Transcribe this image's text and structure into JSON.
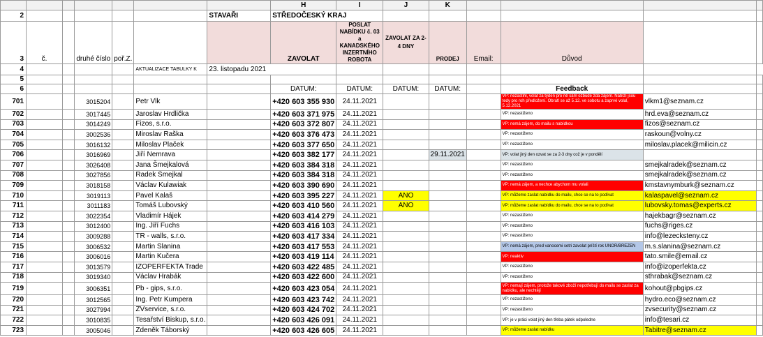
{
  "columns": [
    "H",
    "I",
    "J",
    "K"
  ],
  "header_row2": {
    "stavari": "STAVAŘI",
    "region": "STŘEDOČESKÝ KRAJ"
  },
  "header_row3": {
    "c": "č.",
    "druhe_cislo": "druhé číslo",
    "poz": "poř.Z.",
    "zavolat": "ZAVOLAT",
    "poslat": "POSLAT NABÍDKU č. 03 a KANADSKÉHO INZERTNÍHO ROBOTA",
    "zavolat_24": "ZAVOLAT ZA 2-4 DNY",
    "prodej": "PRODEJ",
    "email": "Email:",
    "duvod": "Důvod"
  },
  "row4": {
    "label": "AKTUALIZACE TABULKY K",
    "value": "23. listopadu 2021"
  },
  "row6": {
    "datum": "DATUM:",
    "feedback": "Feedback"
  },
  "row_numbers_top": [
    "2",
    "3",
    "4",
    "5",
    "6"
  ],
  "rows": [
    {
      "n": "701",
      "code": "3015204",
      "name": "Petr Vlk",
      "phone": "+420 603 355 930",
      "date": "24.11.2021",
      "i": "",
      "j": "",
      "fb": "VP: nezastihl, volat za týden pro ně sám ozbude zda zájem. Nabízí jsou tedy pro roh předložení. Obratl se až 5.12. ve sobotu a zaprvé volal, 5.12.2021",
      "fbcolor": "red",
      "email": "vlkm1@seznam.cz"
    },
    {
      "n": "702",
      "code": "3017445",
      "name": "Jaroslav Hrdlička",
      "phone": "+420 603 371 975",
      "date": "24.11.2021",
      "i": "",
      "j": "",
      "fb": "VP: nezastiženo",
      "fbcolor": "",
      "email": "hrd.eva@seznam.cz"
    },
    {
      "n": "703",
      "code": "3014249",
      "name": "Fizos, s.r.o.",
      "phone": "+420 603 372 807",
      "date": "24.11.2021",
      "i": "",
      "j": "",
      "fb": "VP: nemá zájem, do mailu s nabídkou",
      "fbcolor": "red",
      "email": "fizos@seznam.cz"
    },
    {
      "n": "704",
      "code": "3002536",
      "name": "Miroslav Raška",
      "phone": "+420 603 376 473",
      "date": "24.11.2021",
      "i": "",
      "j": "",
      "fb": "VP: nezastiženo",
      "fbcolor": "",
      "email": "raskoun@volny.cz"
    },
    {
      "n": "705",
      "code": "3016132",
      "name": "Miloslav Plaček",
      "phone": "+420 603 377 650",
      "date": "24.11.2021",
      "i": "",
      "j": "",
      "fb": "VP: nezastiženo",
      "fbcolor": "",
      "email": "miloslav.placek@milicin.cz"
    },
    {
      "n": "706",
      "code": "3016969",
      "name": "Jiří Nemrava",
      "phone": "+420 603 382 177",
      "date": "24.11.2021",
      "i": "",
      "j": "29.11.2021",
      "fb": "VP: volat jiný den ozvat se za 2-3 dny což je v pondělí",
      "fbcolor": "grey",
      "email": ""
    },
    {
      "n": "707",
      "code": "3026408",
      "name": "Jana Šmejkalová",
      "phone": "+420 603 384 318",
      "date": "24.11.2021",
      "i": "",
      "j": "",
      "fb": "VP: nezastiženo",
      "fbcolor": "",
      "email": "smejkalradek@seznam.cz"
    },
    {
      "n": "708",
      "code": "3027856",
      "name": "Radek Šmejkal",
      "phone": "+420 603 384 318",
      "date": "24.11.2021",
      "i": "",
      "j": "",
      "fb": "VP: nezastiženo",
      "fbcolor": "",
      "email": "smejkalradek@seznam.cz"
    },
    {
      "n": "709",
      "code": "3018158",
      "name": "Václav Kulawiak",
      "phone": "+420 603 390 690",
      "date": "24.11.2021",
      "i": "",
      "j": "",
      "fb": "VP: nemá zájem, a nechce abychom mu volali",
      "fbcolor": "red",
      "email": "kmstavnymburk@seznam.cz"
    },
    {
      "n": "710",
      "code": "3019113",
      "name": "Pavel Kalaš",
      "phone": "+420 603 395 227",
      "date": "24.11.2021",
      "i": "ANO",
      "j": "",
      "fb": "VP: můžeme zaslat nabídku do mailu, chce se na to podívat",
      "fbcolor": "yellow",
      "email": "kalaspavel@seznam.cz"
    },
    {
      "n": "711",
      "code": "3011183",
      "name": "Tomáš Lubovský",
      "phone": "+420 603 410 560",
      "date": "24.11.2021",
      "i": "ANO",
      "j": "",
      "fb": "VP: můžeme zaslat nabídku do mailu, chce se na to podívat",
      "fbcolor": "yellow",
      "email": "lubovsky.tomas@experts.cz"
    },
    {
      "n": "712",
      "code": "3022354",
      "name": "Vladimír Hájek",
      "phone": "+420 603 414 279",
      "date": "24.11.2021",
      "i": "",
      "j": "",
      "fb": "VP: nezastiženo",
      "fbcolor": "",
      "email": "hajekbagr@seznam.cz"
    },
    {
      "n": "713",
      "code": "3012400",
      "name": "Ing. Jiří Fuchs",
      "phone": "+420 603 416 103",
      "date": "24.11.2021",
      "i": "",
      "j": "",
      "fb": "VP: nezastiženo",
      "fbcolor": "",
      "email": "fuchs@riges.cz"
    },
    {
      "n": "714",
      "code": "3009288",
      "name": "TR - walls, s.r.o.",
      "phone": "+420 603 417 334",
      "date": "24.11.2021",
      "i": "",
      "j": "",
      "fb": "VP: nezastiženo",
      "fbcolor": "",
      "email": "info@lezecksteny.cz"
    },
    {
      "n": "715",
      "code": "3006532",
      "name": "Martin Slanina",
      "phone": "+420 603 417 553",
      "date": "24.11.2021",
      "i": "",
      "j": "",
      "fb": "VP: nemá zájem, pred vanocemi setri zavolat príští rok UNOR/BREZEN",
      "fbcolor": "blue",
      "email": "m.s.slanina@seznam.cz"
    },
    {
      "n": "716",
      "code": "3006016",
      "name": "Martin Kučera",
      "phone": "+420 603 419 114",
      "date": "24.11.2021",
      "i": "",
      "j": "",
      "fb": "VP: neaktiv",
      "fbcolor": "red",
      "email": "tato.smile@email.cz"
    },
    {
      "n": "717",
      "code": "3013579",
      "name": "IZOPERFEKTA Trade",
      "phone": "+420 603 422 485",
      "date": "24.11.2021",
      "i": "",
      "j": "",
      "fb": "VP: nezastiženo",
      "fbcolor": "",
      "email": "info@izoperfekta.cz"
    },
    {
      "n": "718",
      "code": "3019340",
      "name": "Václav Hrabák",
      "phone": "+420 603 422 600",
      "date": "24.11.2021",
      "i": "",
      "j": "",
      "fb": "VP: nezastiženo",
      "fbcolor": "",
      "email": "sthrabak@seznam.cz"
    },
    {
      "n": "719",
      "code": "3006351",
      "name": "Pb - gips, s.r.o.",
      "phone": "+420 603 423 054",
      "date": "24.11.2021",
      "i": "",
      "j": "",
      "fb": "VP: nemají zájem, protože takové zboží nepotřebují do mailu se zaslat za nabídku, ale nechtějí",
      "fbcolor": "red",
      "email": "kohout@pbgips.cz"
    },
    {
      "n": "720",
      "code": "3012565",
      "name": "Ing. Petr Kumpera",
      "phone": "+420 603 423 742",
      "date": "24.11.2021",
      "i": "",
      "j": "",
      "fb": "VP: nezastiženo",
      "fbcolor": "",
      "email": "hydro.eco@seznam.cz"
    },
    {
      "n": "721",
      "code": "3027994",
      "name": "ZVservice, s.r.o.",
      "phone": "+420 603 424 702",
      "date": "24.11.2021",
      "i": "",
      "j": "",
      "fb": "VP: nezastiženo",
      "fbcolor": "",
      "email": "zvsecurity@seznam.cz"
    },
    {
      "n": "722",
      "code": "3010835",
      "name": "Tesařství Biskup, s.r.o.",
      "phone": "+420 603 426 091",
      "date": "24.11.2021",
      "i": "",
      "j": "",
      "fb": "VP: je v práci volat jiný den třeba pátek odpoledne",
      "fbcolor": "",
      "email": "info@tesari.cz"
    },
    {
      "n": "723",
      "code": "3005046",
      "name": "Zdeněk Táborský",
      "phone": "+420 603 426 605",
      "date": "24.11.2021",
      "i": "",
      "j": "",
      "fb": "VP: můžeme zaslat nabídku",
      "fbcolor": "yellow",
      "email": "Tabitre@seznam.cz"
    }
  ]
}
